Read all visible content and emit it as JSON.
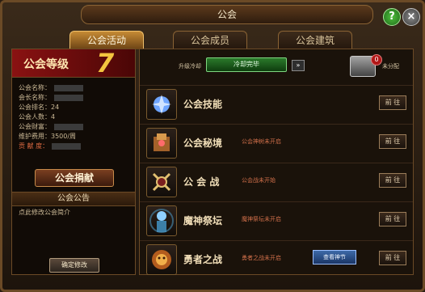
{
  "window": {
    "title": "公会",
    "help_label": "?",
    "close_label": "×"
  },
  "tabs": [
    {
      "label": "公会活动"
    },
    {
      "label": "公会成员"
    },
    {
      "label": "公会建筑"
    }
  ],
  "left": {
    "level_label": "公会等级",
    "level": "7",
    "info": [
      "公会名称：",
      "会长名称：",
      "公会排名：24",
      "公会人数：4",
      "公会财富：",
      "维护费用：3500/周",
      "贡 献 度："
    ],
    "donate_button": "公会捐献",
    "notice_title": "公会公告",
    "notice_text": "点此修改公会简介",
    "edit_button": "确定修改"
  },
  "right": {
    "cooldown_label": "升级冷却",
    "cooldown_value": "冷却完毕",
    "arrow_label": "»",
    "unassigned_label": "未分配",
    "badge_count": "0",
    "rows": [
      {
        "title": "公会技能",
        "status": "",
        "go": "前 往"
      },
      {
        "title": "公会秘境",
        "status": "公会神树未开启",
        "go": "前 往"
      },
      {
        "title": "公 会 战",
        "status": "公会战未开始",
        "go": "前 往"
      },
      {
        "title": "魔神祭坛",
        "status": "魔神祭坛未开启",
        "go": "前 往"
      },
      {
        "title": "勇者之战",
        "status": "勇者之战未开启",
        "go": "前 往",
        "extra_button": "查看神节"
      }
    ]
  },
  "colors": {
    "accent": "#c68b35",
    "frame": "#6b4a26",
    "status_red": "#d06f4a",
    "cooldown_green": "#2b7a2b"
  },
  "icons": [
    "help-icon",
    "close-icon",
    "chest-icon",
    "skill-icon",
    "secret-realm-icon",
    "guild-war-icon",
    "demon-altar-icon",
    "hero-war-icon"
  ]
}
